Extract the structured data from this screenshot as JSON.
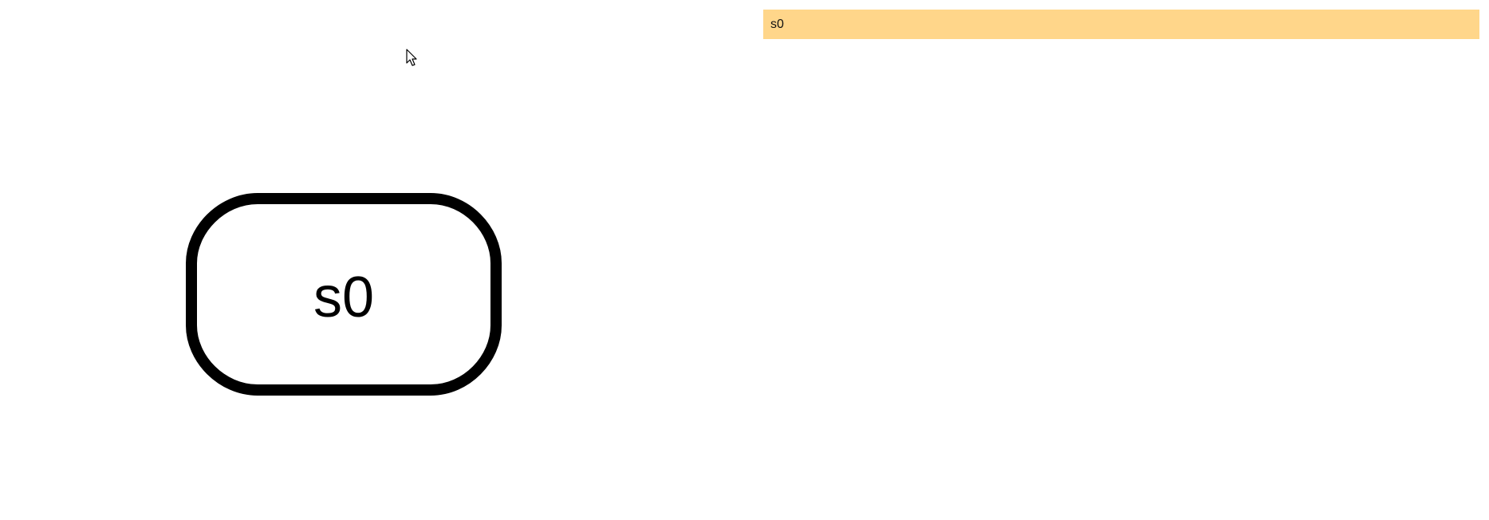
{
  "state_indicator": {
    "text": "s0",
    "background": "#ffd68a"
  },
  "state_node": {
    "label": "s0",
    "stroke": "#000000",
    "fill": "#ffffff"
  },
  "cursor": {
    "icon": "mouse-pointer-icon"
  }
}
